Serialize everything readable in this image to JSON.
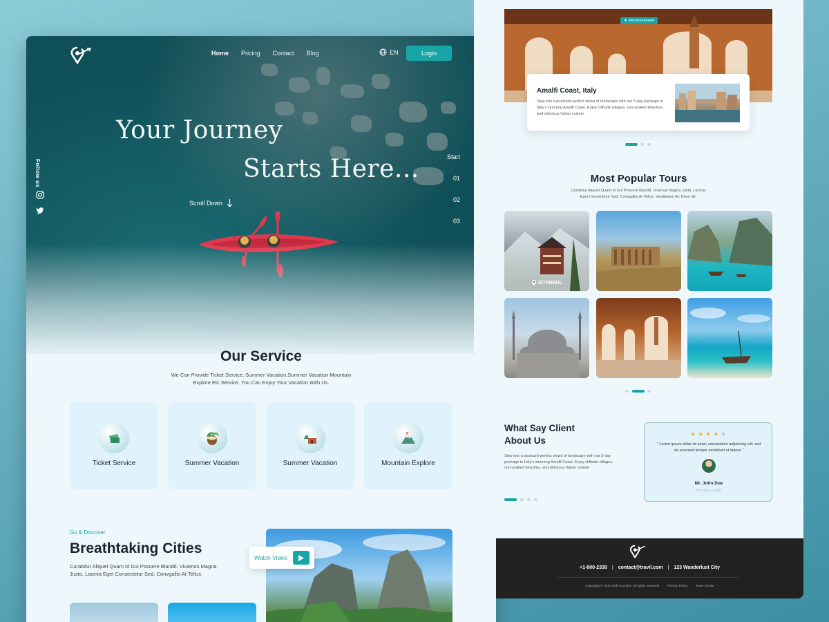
{
  "nav": {
    "links": [
      "Home",
      "Pricing",
      "Contact",
      "Blog"
    ],
    "language": "EN",
    "login_label": "Login"
  },
  "hero": {
    "title_line1": "Your Journey",
    "title_line2": "Starts Here...",
    "scroll_label": "Scroll Down",
    "follow_label": "Follow us",
    "steps": [
      "Start",
      "01",
      "02",
      "03"
    ]
  },
  "service": {
    "title": "Our Service",
    "subtitle": "We Can Provide Ticket Service, Summer Vacation,Summer Vacation Mountain Explore Etc Service. You Can Enjoy Your Vacation With Us.",
    "cards": [
      {
        "label": "Ticket Service",
        "icon": "ticket-icon"
      },
      {
        "label": "Summer Vacation",
        "icon": "coconut-drink-icon"
      },
      {
        "label": "Summer Vacation",
        "icon": "snow-house-icon"
      },
      {
        "label": "Mountain Explore",
        "icon": "mountain-icon"
      }
    ]
  },
  "discover": {
    "eyebrow": "Go & Discover",
    "title": "Breathtaking Cities",
    "subtitle": "Curabitur Aliquet Quam Id Dui Posuere Blandit. Vivamus Magna Justo, Lacinia Eget Consectetur Sed, Convgallis At Tellus.",
    "watch_label": "Watch Video"
  },
  "recommended": {
    "badge": "Recommended",
    "title": "Amalfi Coast, Italy",
    "description": "Step into a postcard-perfect views of landscaps with our 5-day package to Italy's stunning Amalfi Coast. Enjoy cliffside villages, sun-soaked beaches, and delicious Italian cuisine."
  },
  "popular": {
    "title": "Most Popular Tours",
    "subtitle": "Curabitur Aliquet Quam Id Dui Posuere Blandit. Vivamus Magna Justo, Lacinia Eget Consectetur Sed, Convgallis At Tellus. Vestibulum Ac Diam Sit.",
    "first_label": "ISTANBUL"
  },
  "testimonial": {
    "title": "What Say Client About Us",
    "description": "Step into a postcard-perfect views of landscape with our 5-day package to Italy's stunning Amalfi Coast. Enjoy cliffside villages, sun-soaked beaches, and delicious Italian cuisine",
    "rating": 4,
    "max_rating": 5,
    "quote": "\" Lorem ipsum dolor sit amet, consectetur adipiscing elit, sed do eiusmod tempor incididunt ut labore \"",
    "name": "Mr. John Doe",
    "role": "TRAVELLERS"
  },
  "footer": {
    "phone": "+1-800-2330",
    "email": "contact@travil.com",
    "address": "123 Wanderlust City",
    "copyright": "Copyright © 2023 Soft Founder. All rights reserved",
    "privacy": "Privacy Policy",
    "terms": "Team of Use"
  },
  "colors": {
    "accent": "#17a5a8",
    "dark_text": "#1c2330",
    "star": "#f3b323",
    "kayak": "#e0394d"
  }
}
